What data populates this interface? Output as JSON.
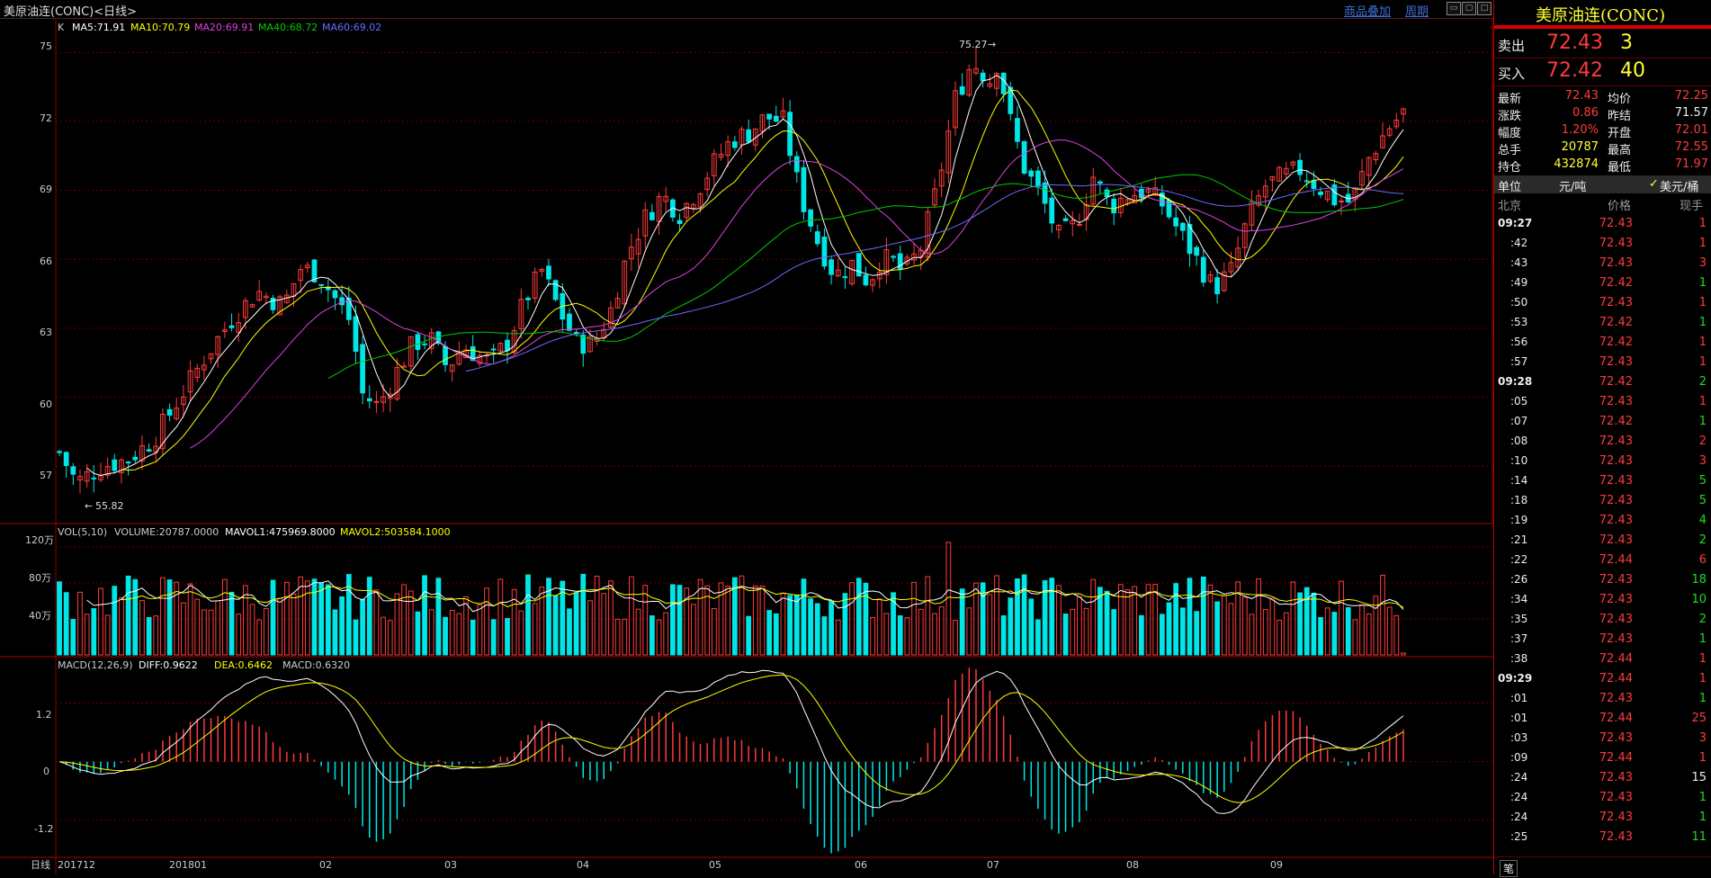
{
  "window": {
    "title": "美原油连(CONC)<日线>",
    "links": [
      "商品叠加",
      "周期"
    ]
  },
  "header_legend": {
    "k": "K",
    "ma5": "MA5:71.91",
    "ma10": "MA10:70.79",
    "ma20": "MA20:69.91",
    "ma40": "MA40:68.72",
    "ma60": "MA60:69.02"
  },
  "colors": {
    "up": "#ff3b3b",
    "down": "#00e6e6",
    "ma5": "#ffffff",
    "ma10": "#ffff00",
    "ma20": "#e040e0",
    "ma40": "#00cc00",
    "ma60": "#6b6bff",
    "grid": "#6b0000"
  },
  "price_axis": {
    "labels": [
      "75",
      "72",
      "69",
      "66",
      "63",
      "60",
      "57"
    ]
  },
  "annotations": {
    "high": "75.27",
    "low": "55.82"
  },
  "volume": {
    "legend_a": "VOL(5,10)",
    "legend_b": "VOLUME:20787.0000",
    "legend_c": "MAVOL1:475969.8000",
    "legend_d": "MAVOL2:503584.1000",
    "axis": [
      "120万",
      "80万",
      "40万"
    ]
  },
  "macd": {
    "legend_a": "MACD(12,26,9)",
    "legend_b": "DIFF:0.9622",
    "legend_c": "DEA:0.6462",
    "legend_d": "MACD:0.6320",
    "axis": [
      "1.2",
      "0",
      "-1.2"
    ]
  },
  "date_axis": {
    "period": "日线",
    "labels": [
      "201712",
      "201801",
      "02",
      "03",
      "04",
      "05",
      "06",
      "07",
      "08",
      "09"
    ]
  },
  "chart_data": {
    "type": "candlestick",
    "title": "美原油连(CONC)<日线>",
    "ylim": [
      54.5,
      76.5
    ],
    "high": 75.27,
    "low": 55.82,
    "volume_ylim": [
      0,
      1300000
    ],
    "macd_ylim": [
      -1.9,
      2.0
    ]
  },
  "quote": {
    "name": "美原油连(CONC)",
    "sell_label": "卖出",
    "sell_price": "72.43",
    "sell_vol": "3",
    "buy_label": "买入",
    "buy_price": "72.42",
    "buy_vol": "40",
    "stats": [
      {
        "l": "最新",
        "v": "72.43",
        "l2": "均价",
        "v2": "72.25"
      },
      {
        "l": "涨跌",
        "v": "0.86",
        "l2": "昨结",
        "v2": "71.57"
      },
      {
        "l": "幅度",
        "v": "1.20%",
        "l2": "开盘",
        "v2": "72.01"
      },
      {
        "l": "总手",
        "v": "20787",
        "l2": "最高",
        "v2": "72.55"
      },
      {
        "l": "持仓",
        "v": "432874",
        "l2": "最低",
        "v2": "71.97"
      }
    ],
    "unit_label": "单位",
    "unit_cny": "元/吨",
    "unit_usd": "美元/桶",
    "unit_check": "✓",
    "tick_headers": [
      "北京",
      "价格",
      "现手"
    ],
    "ticks": [
      {
        "t": "09:27",
        "p": "72.43",
        "v": "1",
        "c": "red",
        "b": true
      },
      {
        "t": ":42",
        "p": "72.43",
        "v": "1",
        "c": "red"
      },
      {
        "t": ":43",
        "p": "72.43",
        "v": "3",
        "c": "red"
      },
      {
        "t": ":49",
        "p": "72.42",
        "v": "1",
        "c": "grn"
      },
      {
        "t": ":50",
        "p": "72.43",
        "v": "1",
        "c": "red"
      },
      {
        "t": ":53",
        "p": "72.42",
        "v": "1",
        "c": "grn"
      },
      {
        "t": ":56",
        "p": "72.42",
        "v": "1",
        "c": "red"
      },
      {
        "t": ":57",
        "p": "72.43",
        "v": "1",
        "c": "red"
      },
      {
        "t": "09:28",
        "p": "72.42",
        "v": "2",
        "c": "grn",
        "b": true
      },
      {
        "t": ":05",
        "p": "72.43",
        "v": "1",
        "c": "red"
      },
      {
        "t": ":07",
        "p": "72.42",
        "v": "1",
        "c": "grn"
      },
      {
        "t": ":08",
        "p": "72.43",
        "v": "2",
        "c": "red"
      },
      {
        "t": ":10",
        "p": "72.43",
        "v": "3",
        "c": "red"
      },
      {
        "t": ":14",
        "p": "72.43",
        "v": "5",
        "c": "grn"
      },
      {
        "t": ":18",
        "p": "72.43",
        "v": "5",
        "c": "grn"
      },
      {
        "t": ":19",
        "p": "72.43",
        "v": "4",
        "c": "grn"
      },
      {
        "t": ":21",
        "p": "72.43",
        "v": "2",
        "c": "grn"
      },
      {
        "t": ":22",
        "p": "72.44",
        "v": "6",
        "c": "red"
      },
      {
        "t": ":26",
        "p": "72.43",
        "v": "18",
        "c": "grn"
      },
      {
        "t": ":34",
        "p": "72.43",
        "v": "10",
        "c": "grn"
      },
      {
        "t": ":35",
        "p": "72.43",
        "v": "2",
        "c": "grn"
      },
      {
        "t": ":37",
        "p": "72.43",
        "v": "1",
        "c": "grn"
      },
      {
        "t": ":38",
        "p": "72.44",
        "v": "1",
        "c": "red"
      },
      {
        "t": "09:29",
        "p": "72.44",
        "v": "1",
        "c": "red",
        "b": true
      },
      {
        "t": ":01",
        "p": "72.43",
        "v": "1",
        "c": "grn"
      },
      {
        "t": ":01",
        "p": "72.44",
        "v": "25",
        "c": "red"
      },
      {
        "t": ":03",
        "p": "72.43",
        "v": "3",
        "c": "red"
      },
      {
        "t": ":09",
        "p": "72.44",
        "v": "1",
        "c": "red"
      },
      {
        "t": ":24",
        "p": "72.43",
        "v": "15",
        "c": "wht"
      },
      {
        "t": ":24",
        "p": "72.43",
        "v": "1",
        "c": "grn"
      },
      {
        "t": ":24",
        "p": "72.43",
        "v": "1",
        "c": "grn"
      },
      {
        "t": ":25",
        "p": "72.43",
        "v": "11",
        "c": "grn"
      }
    ],
    "bottom_tab": "笔"
  }
}
